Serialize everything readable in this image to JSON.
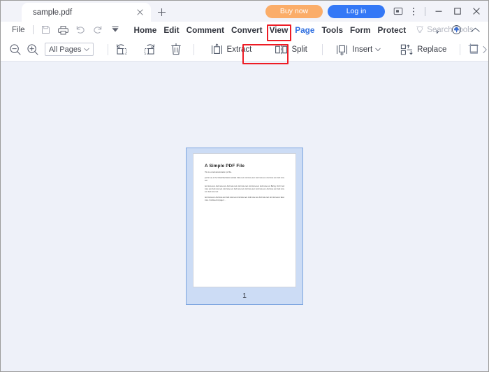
{
  "window": {
    "tab": {
      "title": "sample.pdf",
      "close_icon": "close-icon",
      "new_tab_icon": "plus-icon"
    },
    "buy_label": "Buy now",
    "login_label": "Log in",
    "feedback_icon": "comment-icon",
    "more_icon": "kebab-menu-icon",
    "minimize_icon": "minimize-icon",
    "maximize_icon": "maximize-icon",
    "close_icon": "window-close-icon"
  },
  "menubar": {
    "file_label": "File",
    "quick_actions": [
      {
        "name": "save-icon",
        "enabled": false
      },
      {
        "name": "print-icon",
        "enabled": true
      },
      {
        "name": "undo-icon",
        "enabled": false
      },
      {
        "name": "redo-icon",
        "enabled": false
      },
      {
        "name": "quick-access-caret-icon",
        "enabled": true
      }
    ],
    "items": [
      {
        "label": "Home",
        "selected": false
      },
      {
        "label": "Edit",
        "selected": false
      },
      {
        "label": "Comment",
        "selected": false
      },
      {
        "label": "Convert",
        "selected": false
      },
      {
        "label": "View",
        "selected": false
      },
      {
        "label": "Page",
        "selected": true,
        "highlighted": true
      },
      {
        "label": "Tools",
        "selected": false
      },
      {
        "label": "Form",
        "selected": false
      },
      {
        "label": "Protect",
        "selected": false
      }
    ],
    "search_label": "Search Tools",
    "search_icon": "lightbulb-icon",
    "right_icons": [
      "share-send-icon",
      "cloud-upload-icon",
      "collapse-ribbon-icon"
    ]
  },
  "toolbar": {
    "zoom_out_icon": "zoom-out-icon",
    "zoom_in_icon": "zoom-in-icon",
    "page_range": {
      "value": "All Pages",
      "caret_icon": "chevron-down-icon"
    },
    "rotate_left_icon": "rotate-left-icon",
    "rotate_right_icon": "rotate-right-icon",
    "delete_icon": "delete-page-icon",
    "actions": [
      {
        "label": "Extract",
        "icon": "extract-pages-icon",
        "highlighted": true,
        "dropdown": false
      },
      {
        "label": "Split",
        "icon": "split-pages-icon",
        "highlighted": false,
        "dropdown": false
      },
      {
        "label": "Insert",
        "icon": "insert-pages-icon",
        "highlighted": false,
        "dropdown": true
      },
      {
        "label": "Replace",
        "icon": "replace-pages-icon",
        "highlighted": false,
        "dropdown": false
      }
    ],
    "crop_icon": "crop-icon",
    "overflow_icon": "chevron-right-icon"
  },
  "document": {
    "page_number": "1",
    "page": {
      "title": "A Simple PDF File",
      "subtitle": "This is a small demonstration .pdf file -",
      "paragraphs": [
        "just for use in the Virtual Mechanics tutorials. More text. And more text. And more text. And more text. And more text.",
        "And more text. And more text. And more text. And more text. And more text. And more text. Boring, zzzzz. And more text. And more text. And more text. And more text. And more text. And more text. And more text. And more text. And more text.",
        "And more text. And more text. And more text. And more text. And more text. And more text. And more text. Even more. Continued on page 2 ..."
      ]
    }
  },
  "colors": {
    "accent_blue": "#3478f6",
    "buy_orange": "#fbad69",
    "highlight_red": "#ee1c25",
    "canvas": "#eef1f9",
    "selection_blue": "#ccdcf5"
  }
}
